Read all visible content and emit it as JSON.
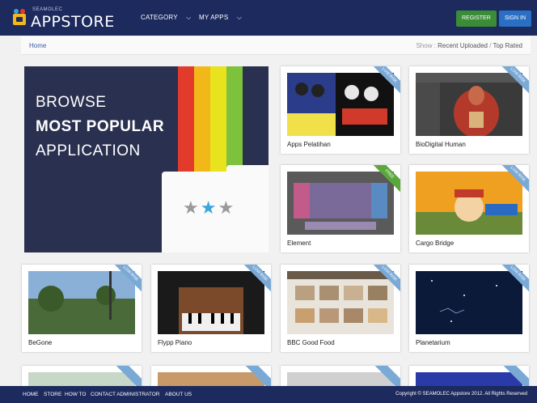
{
  "header": {
    "logo_small": "SEAMOLEC",
    "logo_main": "APPSTORE",
    "nav": [
      {
        "label": "CATEGORY"
      },
      {
        "label": "MY APPS"
      }
    ],
    "register_label": "REGISTER",
    "signin_label": "SIGN IN"
  },
  "breadcrumb": {
    "home": "Home",
    "show_label": "Show :",
    "recent": "Recent Uploaded",
    "separator": "/",
    "top": "Top Rated"
  },
  "hero": {
    "line1": "BROWSE",
    "line2": "MOST POPULAR",
    "line3": "APPLICATION",
    "stars": [
      "★",
      "★",
      "★"
    ],
    "stripe_colors": [
      "#e23b2b",
      "#f2b81a",
      "#e8e31c",
      "#7ec13c"
    ]
  },
  "apps": [
    {
      "title": "Apps Pelatihan",
      "ribbon": "LOW RISK",
      "ribbon_color": "blue"
    },
    {
      "title": "BioDigital Human",
      "ribbon": "LOW RISK",
      "ribbon_color": "blue"
    },
    {
      "title": "Element",
      "ribbon": "FREE",
      "ribbon_color": "green"
    },
    {
      "title": "Cargo Bridge",
      "ribbon": "LOW RISK",
      "ribbon_color": "blue"
    },
    {
      "title": "BeGone",
      "ribbon": "LOW RISK",
      "ribbon_color": "blue"
    },
    {
      "title": "Flypp Piano",
      "ribbon": "LOW RISK",
      "ribbon_color": "blue"
    },
    {
      "title": "BBC Good Food",
      "ribbon": "LOW RISK",
      "ribbon_color": "blue"
    },
    {
      "title": "Planetarium",
      "ribbon": "LOW RISK",
      "ribbon_color": "blue"
    }
  ],
  "footer": {
    "links": [
      "HOME",
      "STORE",
      "HOW TO",
      "CONTACT ADMINISTRATOR",
      "ABOUT US"
    ],
    "copyright": "Copyright © SEAMOLEC Appstore 2012. All Rights Reserved"
  }
}
